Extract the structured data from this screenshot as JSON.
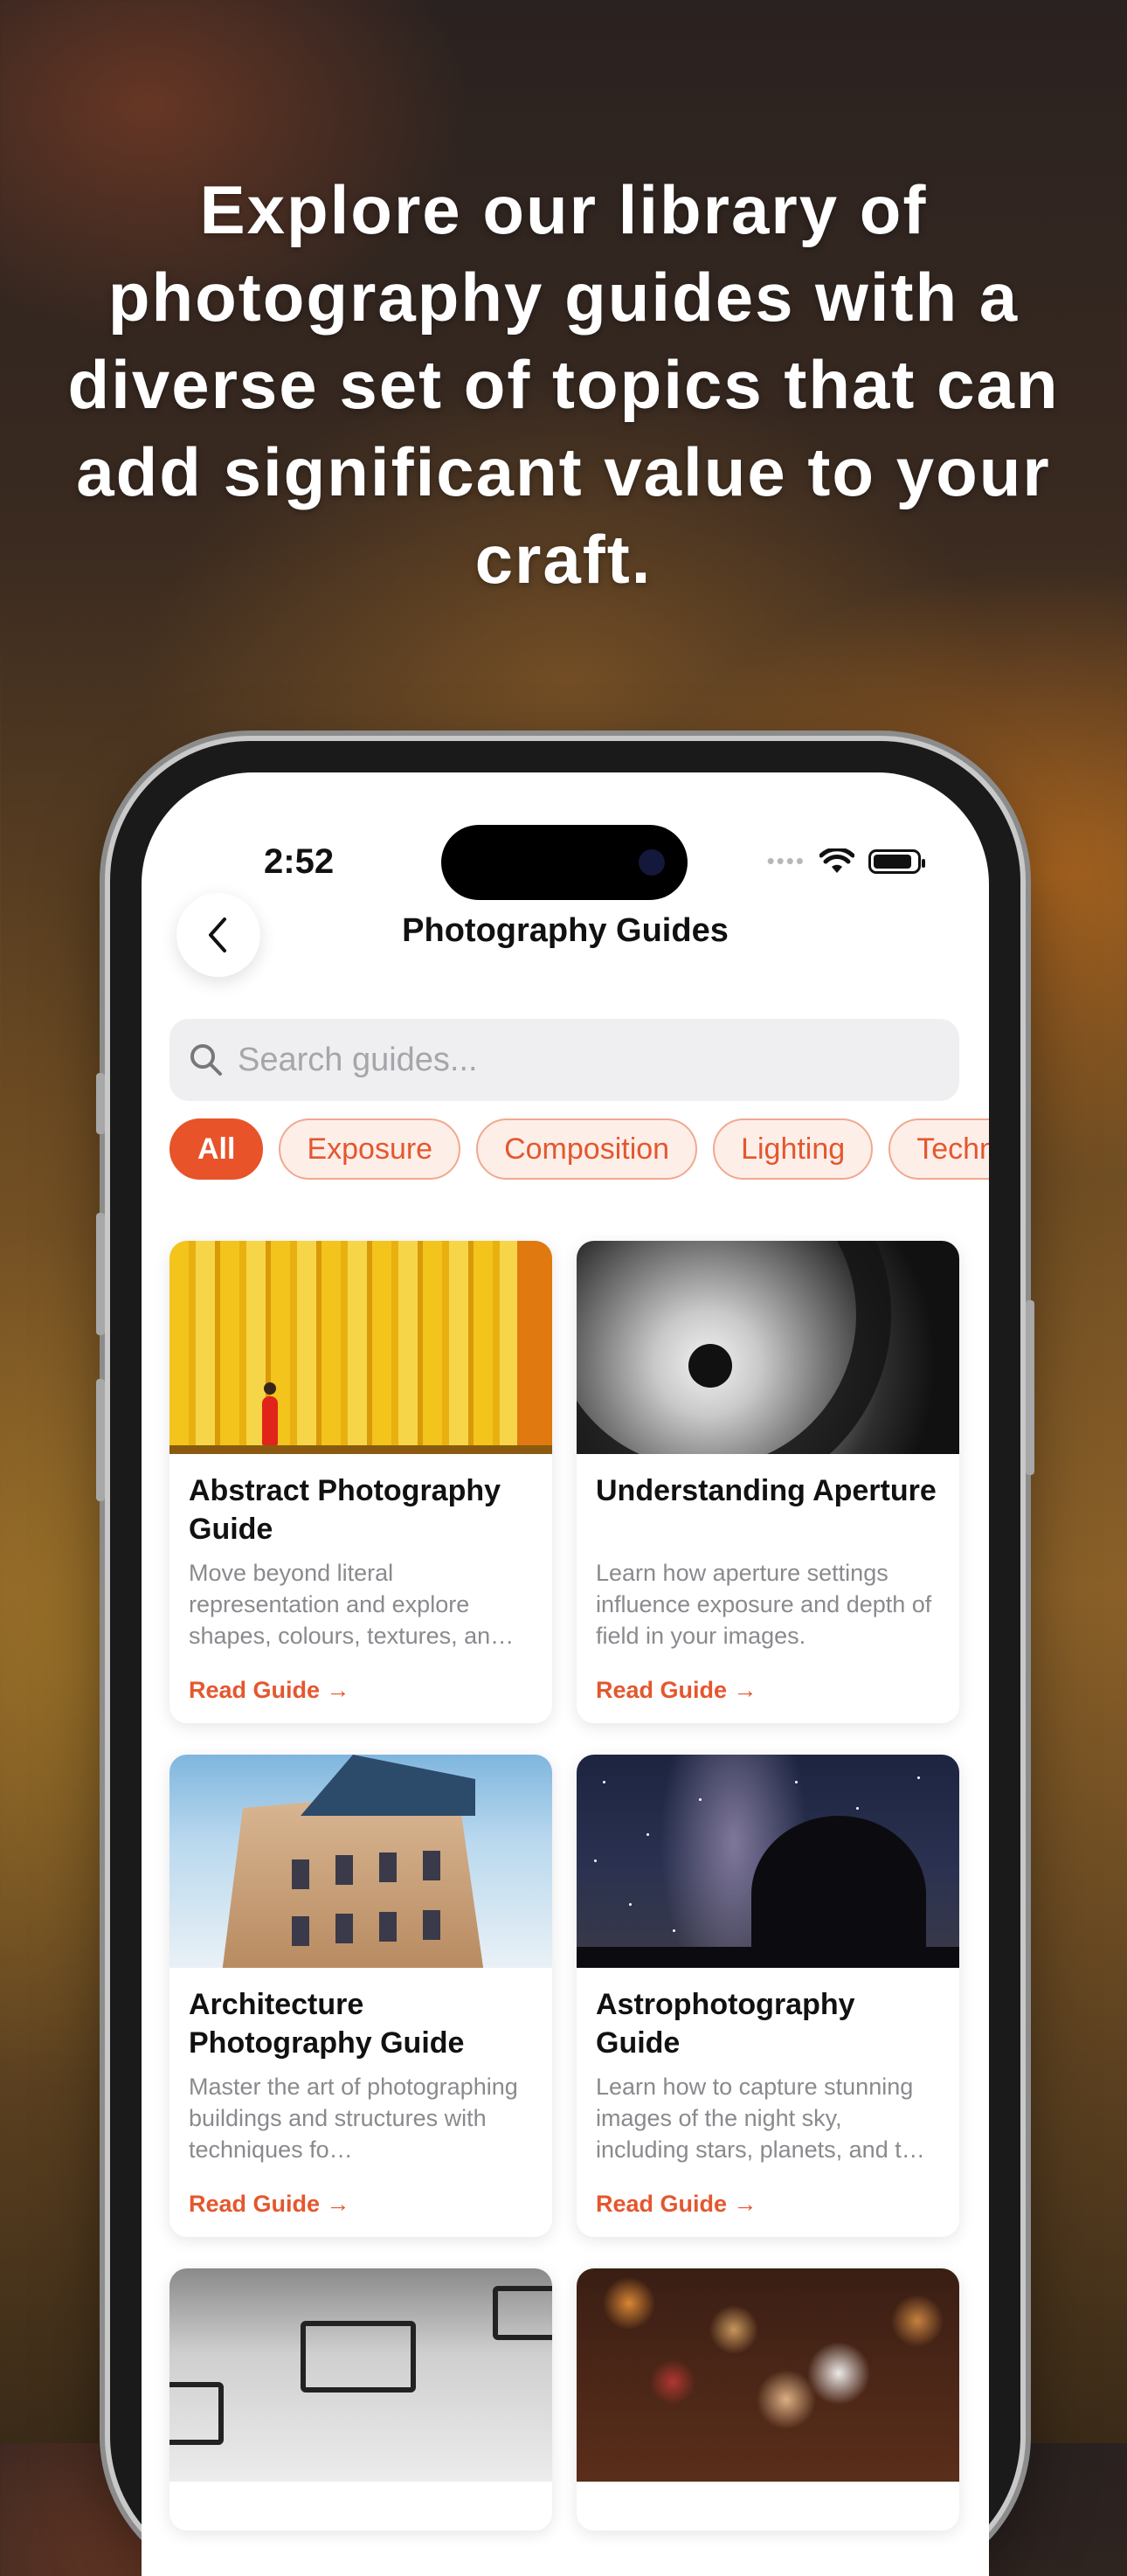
{
  "headline": "Explore our library of photography guides with a diverse set of topics that can add significant value to your craft.",
  "status_bar": {
    "time": "2:52",
    "signal_icon": "signal-dots-icon",
    "wifi_icon": "wifi-icon",
    "battery_icon": "battery-icon"
  },
  "nav": {
    "title": "Photography Guides",
    "back_icon": "chevron-left-icon"
  },
  "search": {
    "placeholder": "Search guides...",
    "value": "",
    "icon": "search-icon"
  },
  "filters": [
    {
      "label": "All",
      "active": true
    },
    {
      "label": "Exposure",
      "active": false
    },
    {
      "label": "Composition",
      "active": false
    },
    {
      "label": "Lighting",
      "active": false
    },
    {
      "label": "Techn",
      "active": false
    }
  ],
  "guides": [
    {
      "title": "Abstract Photography Guide",
      "description": "Move beyond literal representation and explore shapes, colours, textures, an…",
      "link": "Read Guide →"
    },
    {
      "title": "Understanding Aperture",
      "description": "Learn how aperture settings influence exposure and depth of field in your images.",
      "link": "Read Guide →"
    },
    {
      "title": "Architecture Photography Guide",
      "description": "Master the art of photographing buildings and structures with techniques fo…",
      "link": "Read Guide →"
    },
    {
      "title": "Astrophotography Guide",
      "description": "Learn how to capture stunning images of the night sky, including stars, planets, and t…",
      "link": "Read Guide →"
    }
  ],
  "colors": {
    "accent": "#e8532a",
    "chip_bg": "#fdeee8",
    "chip_border": "#f0a98f"
  }
}
